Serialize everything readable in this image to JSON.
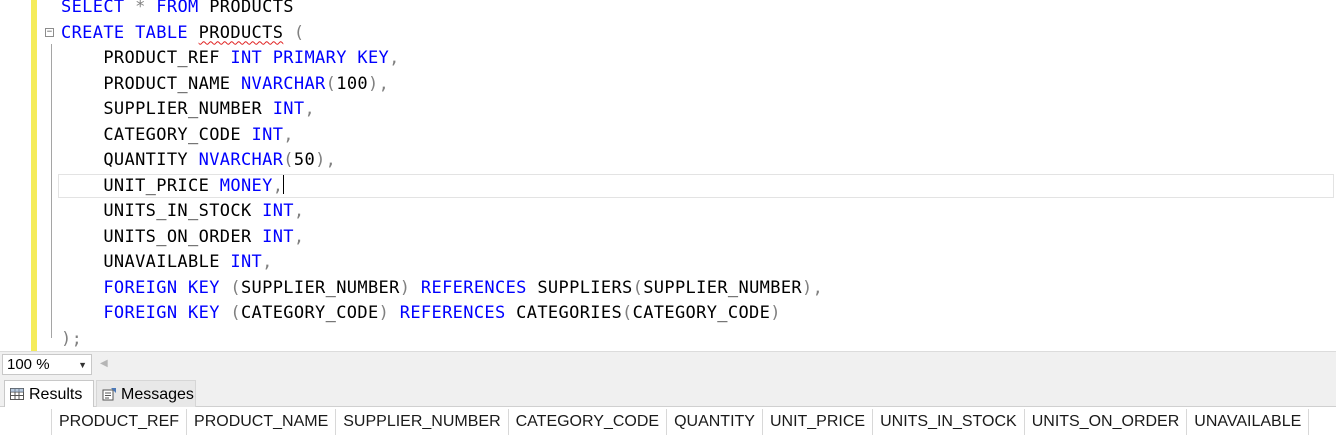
{
  "editor": {
    "lines": [
      {
        "segments": [
          {
            "t": "SELECT",
            "c": "kw"
          },
          {
            "t": " * ",
            "c": "gr"
          },
          {
            "t": "FROM",
            "c": "kw"
          },
          {
            "t": " PRODUCTS"
          }
        ]
      },
      {
        "segments": [
          {
            "t": "CREATE TABLE",
            "c": "kw"
          },
          {
            "t": " "
          },
          {
            "t": "PRODUCTS",
            "c": "sq"
          },
          {
            "t": " (",
            "c": "gr"
          }
        ]
      },
      {
        "segments": [
          {
            "t": "    PRODUCT_REF "
          },
          {
            "t": "INT PRIMARY KEY",
            "c": "kw"
          },
          {
            "t": ",",
            "c": "gr"
          }
        ]
      },
      {
        "segments": [
          {
            "t": "    PRODUCT_NAME "
          },
          {
            "t": "NVARCHAR",
            "c": "kw"
          },
          {
            "t": "(",
            "c": "gr"
          },
          {
            "t": "100"
          },
          {
            "t": "),",
            "c": "gr"
          }
        ]
      },
      {
        "segments": [
          {
            "t": "    SUPPLIER_NUMBER "
          },
          {
            "t": "INT",
            "c": "kw"
          },
          {
            "t": ",",
            "c": "gr"
          }
        ]
      },
      {
        "segments": [
          {
            "t": "    CATEGORY_CODE "
          },
          {
            "t": "INT",
            "c": "kw"
          },
          {
            "t": ",",
            "c": "gr"
          }
        ]
      },
      {
        "segments": [
          {
            "t": "    QUANTITY "
          },
          {
            "t": "NVARCHAR",
            "c": "kw"
          },
          {
            "t": "(",
            "c": "gr"
          },
          {
            "t": "50"
          },
          {
            "t": "),",
            "c": "gr"
          }
        ]
      },
      {
        "segments": [
          {
            "t": "    UNIT_PRICE "
          },
          {
            "t": "MONEY",
            "c": "kw"
          },
          {
            "t": ",",
            "c": "gr"
          }
        ],
        "caret": true
      },
      {
        "segments": [
          {
            "t": "    UNITS_IN_STOCK "
          },
          {
            "t": "INT",
            "c": "kw"
          },
          {
            "t": ",",
            "c": "gr"
          }
        ]
      },
      {
        "segments": [
          {
            "t": "    UNITS_ON_ORDER "
          },
          {
            "t": "INT",
            "c": "kw"
          },
          {
            "t": ",",
            "c": "gr"
          }
        ]
      },
      {
        "segments": [
          {
            "t": "    UNAVAILABLE "
          },
          {
            "t": "INT",
            "c": "kw"
          },
          {
            "t": ",",
            "c": "gr"
          }
        ]
      },
      {
        "segments": [
          {
            "t": "    "
          },
          {
            "t": "FOREIGN KEY",
            "c": "kw"
          },
          {
            "t": " (",
            "c": "gr"
          },
          {
            "t": "SUPPLIER_NUMBER"
          },
          {
            "t": ") ",
            "c": "gr"
          },
          {
            "t": "REFERENCES",
            "c": "kw"
          },
          {
            "t": " SUPPLIERS"
          },
          {
            "t": "(",
            "c": "gr"
          },
          {
            "t": "SUPPLIER_NUMBER"
          },
          {
            "t": "),",
            "c": "gr"
          }
        ]
      },
      {
        "segments": [
          {
            "t": "    "
          },
          {
            "t": "FOREIGN KEY",
            "c": "kw"
          },
          {
            "t": " (",
            "c": "gr"
          },
          {
            "t": "CATEGORY_CODE"
          },
          {
            "t": ") ",
            "c": "gr"
          },
          {
            "t": "REFERENCES",
            "c": "kw"
          },
          {
            "t": " CATEGORIES"
          },
          {
            "t": "(",
            "c": "gr"
          },
          {
            "t": "CATEGORY_CODE"
          },
          {
            "t": ")",
            "c": "gr"
          }
        ]
      },
      {
        "segments": [
          {
            "t": ");",
            "c": "gr"
          }
        ]
      }
    ]
  },
  "zoom": {
    "value": "100 %",
    "arrow_icon": "dropdown-arrow-icon"
  },
  "tabs": [
    {
      "label": "Results",
      "icon": "grid-icon",
      "selected": true
    },
    {
      "label": "Messages",
      "icon": "messages-icon",
      "selected": false
    }
  ],
  "results": {
    "columns": [
      "PRODUCT_REF",
      "PRODUCT_NAME",
      "SUPPLIER_NUMBER",
      "CATEGORY_CODE",
      "QUANTITY",
      "UNIT_PRICE",
      "UNITS_IN_STOCK",
      "UNITS_ON_ORDER",
      "UNAVAILABLE"
    ]
  },
  "colors": {
    "keyword": "#0000ff",
    "punctuation": "#808080",
    "change_bar": "#f5ec5a",
    "squiggle": "#e02020"
  }
}
